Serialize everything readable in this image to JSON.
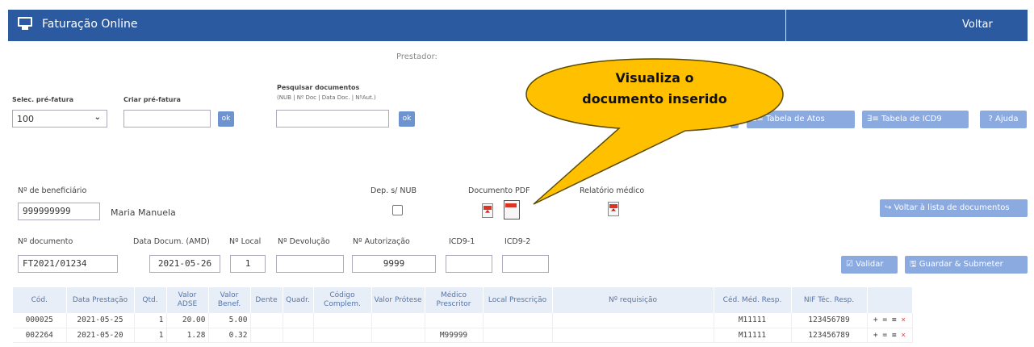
{
  "header": {
    "title": "Faturação Online",
    "back_label": "Voltar"
  },
  "prestador_label": "Prestador:",
  "filters": {
    "selec_label": "Selec. pré-fatura",
    "selec_value": "100",
    "criar_label": "Criar pré-fatura",
    "criar_value": "",
    "pesquisar_label": "Pesquisar documentos",
    "pesquisar_hint": "(NUB | Nº Doc | Data Doc. | NºAut.)",
    "pesquisar_value": "",
    "ok_label": "ok"
  },
  "toolbar": {
    "atos_label": "Tabela de Atos",
    "icd9_label": "Tabela de ICD9",
    "ajuda_label": "? Ajuda"
  },
  "callout": {
    "line1": "Visualiza o",
    "line2": "documento inserido"
  },
  "beneficiario": {
    "label": "Nº de beneficiário",
    "value": "999999999",
    "name": "Maria Manuela",
    "dep_label": "Dep. s/ NUB",
    "pdf_label": "Documento PDF",
    "relatorio_label": "Relatório médico",
    "voltar_lista_label": "Voltar à lista de documentos"
  },
  "documento": {
    "num_label": "Nº documento",
    "num_value": "FT2021/01234",
    "data_label": "Data Docum. (AMD)",
    "data_value": "2021-05-26",
    "local_label": "Nº Local",
    "local_value": "1",
    "devolucao_label": "Nº Devolução",
    "devolucao_value": "",
    "autorizacao_label": "Nº Autorização",
    "autorizacao_value": "9999",
    "icd1_label": "ICD9-1",
    "icd1_value": "",
    "icd2_label": "ICD9-2",
    "icd2_value": "",
    "validar_label": "Validar",
    "guardar_label": "Guardar & Submeter"
  },
  "table": {
    "headers": [
      "Cód.",
      "Data Prestação",
      "Qtd.",
      "Valor ADSE",
      "Valor Benef.",
      "Dente",
      "Quadr.",
      "Código Complem.",
      "Valor Prótese",
      "Médico Prescritor",
      "Local Prescrição",
      "Nº requisição",
      "Céd. Méd. Resp.",
      "NIF Téc. Resp.",
      ""
    ],
    "rows": [
      [
        "000025",
        "2021-05-25",
        "1",
        "20.00",
        "5.00",
        "",
        "",
        "",
        "",
        "",
        "",
        "",
        "M11111",
        "123456789"
      ],
      [
        "002264",
        "2021-05-20",
        "1",
        "1.28",
        "0.32",
        "",
        "",
        "",
        "",
        "M99999",
        "",
        "",
        "M11111",
        "123456789"
      ]
    ]
  }
}
